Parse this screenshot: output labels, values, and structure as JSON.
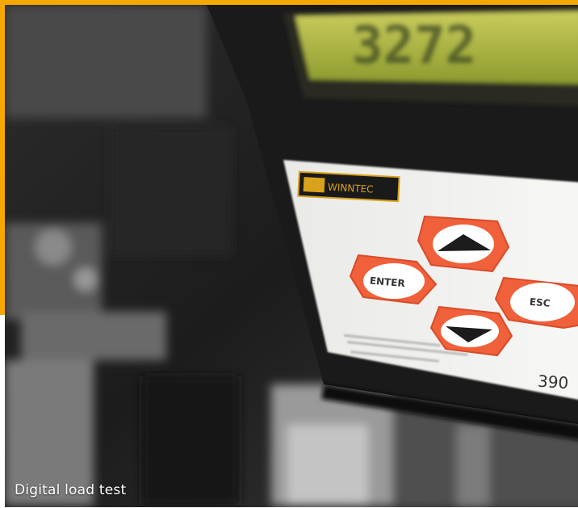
{
  "caption": "Digital load test",
  "device": {
    "brand_logo": "WINNTEC",
    "display_reading": "3272",
    "buttons": [
      {
        "name": "up",
        "label": ""
      },
      {
        "name": "enter",
        "label": "ENTER"
      },
      {
        "name": "esc",
        "label": "ESC"
      },
      {
        "name": "down",
        "label": ""
      }
    ],
    "partial_model_number": "390"
  },
  "colors": {
    "accent": "#f5a800",
    "button": "#f0603a",
    "lcd": "#b8c040"
  }
}
